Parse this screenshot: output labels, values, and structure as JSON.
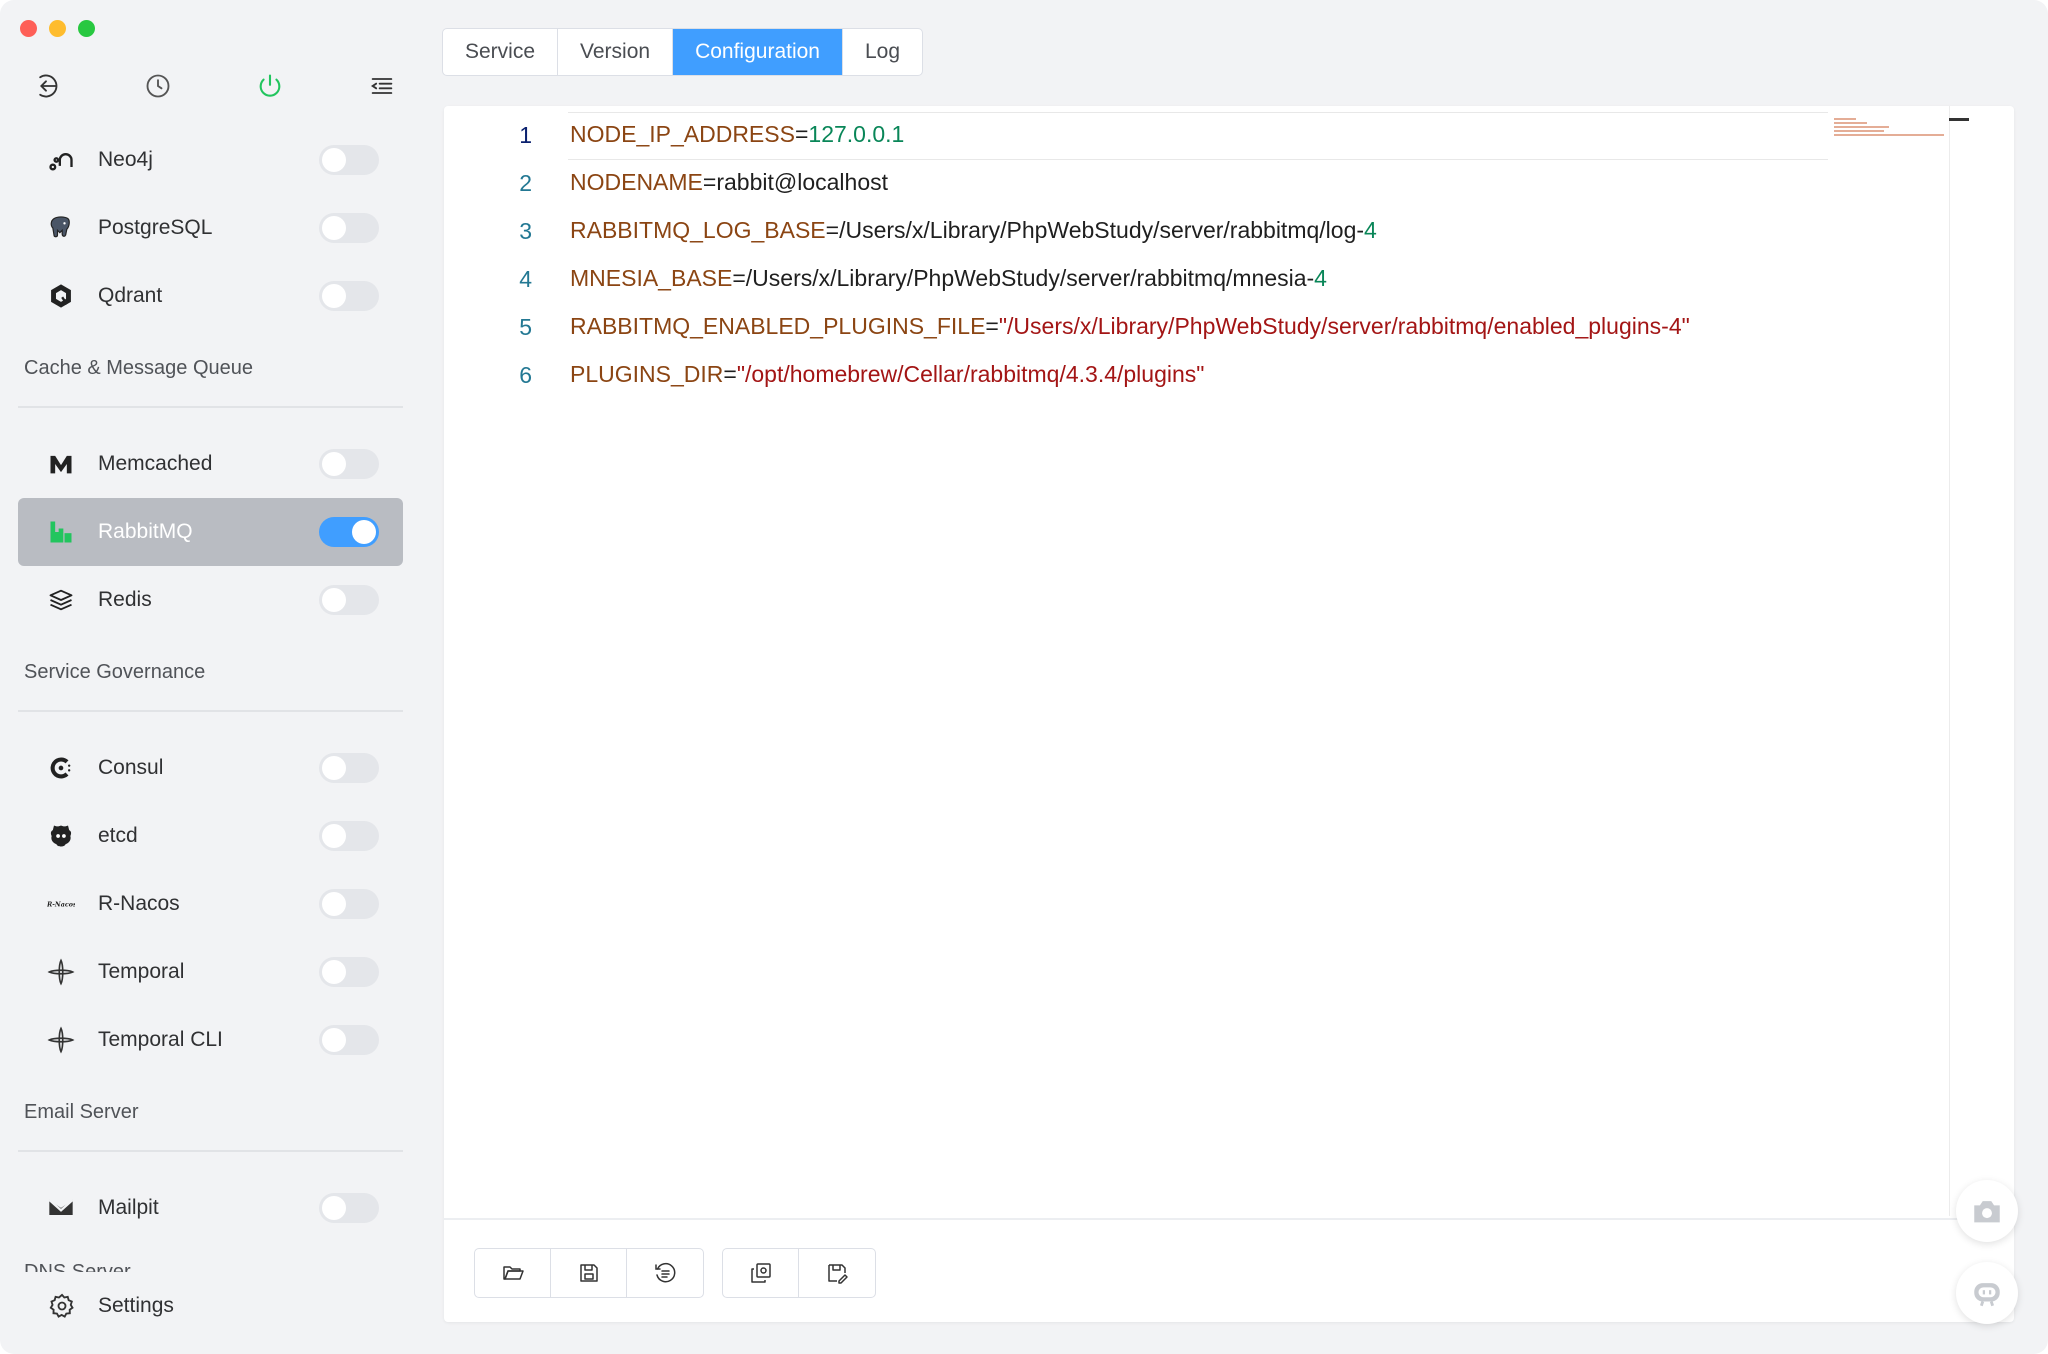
{
  "window": {
    "controls": [
      "close",
      "minimize",
      "maximize"
    ]
  },
  "sidebar": {
    "top_icons": [
      "back-icon",
      "history-icon",
      "power-icon",
      "menu-collapse-icon"
    ],
    "groups": [
      {
        "title": "",
        "items": [
          {
            "label": "Neo4j",
            "icon": "neo4j-icon",
            "enabled": false
          },
          {
            "label": "PostgreSQL",
            "icon": "postgresql-icon",
            "enabled": false
          },
          {
            "label": "Qdrant",
            "icon": "qdrant-icon",
            "enabled": false
          }
        ]
      },
      {
        "title": "Cache & Message Queue",
        "items": [
          {
            "label": "Memcached",
            "icon": "memcached-icon",
            "enabled": false
          },
          {
            "label": "RabbitMQ",
            "icon": "rabbitmq-icon",
            "enabled": true,
            "active": true
          },
          {
            "label": "Redis",
            "icon": "redis-icon",
            "enabled": false
          }
        ]
      },
      {
        "title": "Service Governance",
        "items": [
          {
            "label": "Consul",
            "icon": "consul-icon",
            "enabled": false
          },
          {
            "label": "etcd",
            "icon": "etcd-icon",
            "enabled": false
          },
          {
            "label": "R-Nacos",
            "icon": "r-nacos-icon",
            "enabled": false
          },
          {
            "label": "Temporal",
            "icon": "temporal-icon",
            "enabled": false
          },
          {
            "label": "Temporal CLI",
            "icon": "temporal-cli-icon",
            "enabled": false
          }
        ]
      },
      {
        "title": "Email Server",
        "items": [
          {
            "label": "Mailpit",
            "icon": "mailpit-icon",
            "enabled": false
          }
        ]
      }
    ],
    "partial_group_title": "DNS Server",
    "settings_label": "Settings"
  },
  "tabs": {
    "items": [
      "Service",
      "Version",
      "Configuration",
      "Log"
    ],
    "active": "Configuration"
  },
  "editor": {
    "lines": [
      {
        "n": "1",
        "tokens": [
          {
            "t": "NODE_IP_ADDRESS",
            "c": "k"
          },
          {
            "t": "=",
            "c": "plain"
          },
          {
            "t": "127.0.0.1",
            "c": "num"
          }
        ]
      },
      {
        "n": "2",
        "tokens": [
          {
            "t": "NODENAME",
            "c": "k"
          },
          {
            "t": "=rabbit@localhost",
            "c": "plain"
          }
        ]
      },
      {
        "n": "3",
        "tokens": [
          {
            "t": "RABBITMQ_LOG_BASE",
            "c": "k"
          },
          {
            "t": "=/Users/x/Library/PhpWebStudy/server/rabbitmq/log-",
            "c": "plain"
          },
          {
            "t": "4",
            "c": "num"
          }
        ]
      },
      {
        "n": "4",
        "tokens": [
          {
            "t": "MNESIA_BASE",
            "c": "k"
          },
          {
            "t": "=/Users/x/Library/PhpWebStudy/server/rabbitmq/mnesia-",
            "c": "plain"
          },
          {
            "t": "4",
            "c": "num"
          }
        ]
      },
      {
        "n": "5",
        "tokens": [
          {
            "t": "RABBITMQ_ENABLED_PLUGINS_FILE",
            "c": "k"
          },
          {
            "t": "=",
            "c": "plain"
          },
          {
            "t": "\"/Users/x/Library/PhpWebStudy/server/rabbitmq/enabled_plugins-4\"",
            "c": "str"
          }
        ]
      },
      {
        "n": "6",
        "tokens": [
          {
            "t": "PLUGINS_DIR",
            "c": "k"
          },
          {
            "t": "=",
            "c": "plain"
          },
          {
            "t": "\"/opt/homebrew/Cellar/rabbitmq/4.3.4/plugins\"",
            "c": "str"
          }
        ]
      }
    ]
  },
  "toolbar": {
    "group1": [
      "open-folder-icon",
      "save-icon",
      "format-icon"
    ],
    "group2": [
      "load-default-icon",
      "save-as-icon"
    ]
  },
  "floating": [
    "screenshot-icon",
    "ai-assistant-icon"
  ],
  "colors": {
    "accent": "#409eff",
    "active_item_bg": "#b9bcc2",
    "key": "#8b4513",
    "number": "#098658",
    "string": "#a31515"
  }
}
